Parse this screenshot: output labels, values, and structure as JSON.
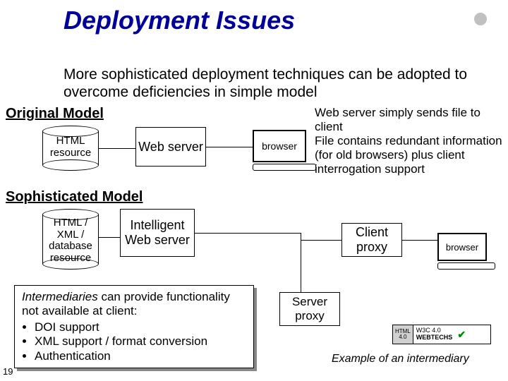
{
  "title": "Deployment Issues",
  "intro": "More sophisticated deployment techniques can be adopted to overcome deficiencies in simple model",
  "sections": {
    "original": "Original Model",
    "sophisticated": "Sophisticated Model"
  },
  "original": {
    "resource": "HTML resource",
    "server": "Web server",
    "browser": "browser",
    "note": "Web server simply sends file to client\nFile contains redundant information (for old browsers) plus client interrogation support"
  },
  "soph": {
    "resource": "HTML / XML / database resource",
    "server": "Intelligent Web server",
    "client_proxy": "Client proxy",
    "server_proxy": "Server proxy",
    "browser": "browser"
  },
  "intermediaries": {
    "lead": "Intermediaries",
    "body": " can provide functionality not available at client:",
    "items": [
      "DOI support",
      "XML support / format conversion",
      "Authentication"
    ]
  },
  "badge": {
    "html": "HTML",
    "v": "4.0",
    "w3c": "W3C 4.0",
    "brand": "WEBTECHS"
  },
  "example": "Example of an intermediary",
  "page": "19"
}
